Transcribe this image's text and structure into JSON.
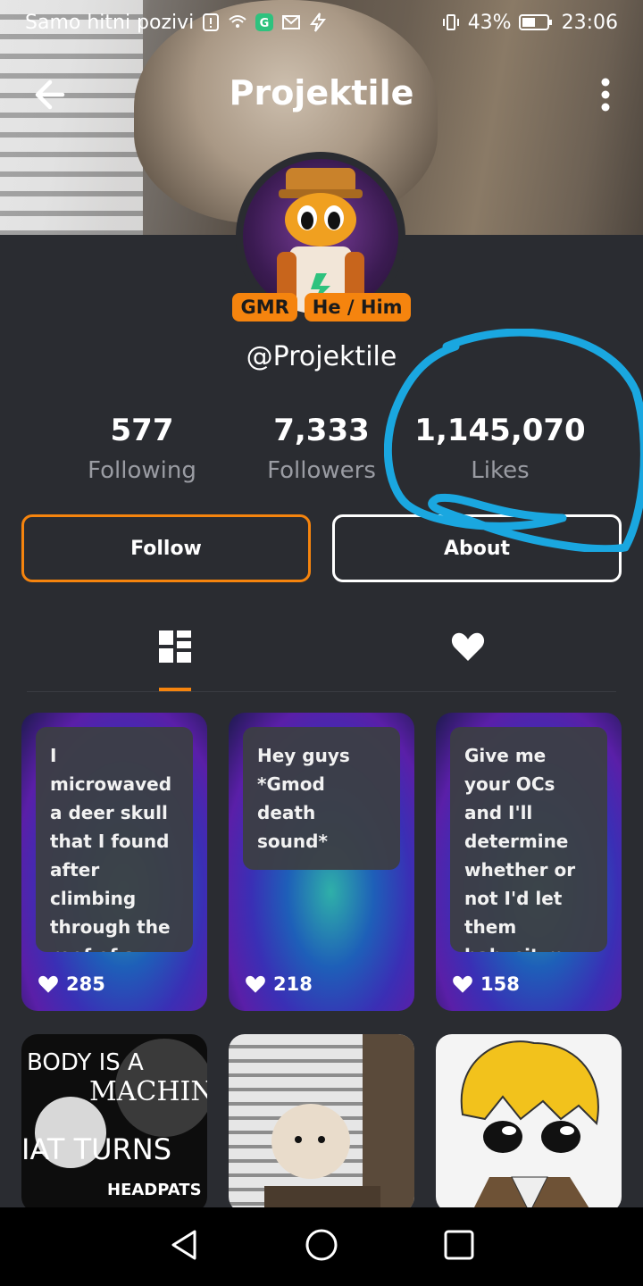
{
  "status_bar": {
    "carrier": "Samo hitni pozivi",
    "battery": "43%",
    "time": "23:06"
  },
  "header": {
    "title": "Projektile"
  },
  "profile": {
    "badges": [
      "GMR",
      "He / Him"
    ],
    "handle": "@Projektile",
    "stats": [
      {
        "value": "577",
        "label": "Following"
      },
      {
        "value": "7,333",
        "label": "Followers"
      },
      {
        "value": "1,145,070",
        "label": "Likes"
      }
    ]
  },
  "actions": {
    "follow": "Follow",
    "about": "About"
  },
  "tabs": [
    {
      "icon": "grid-icon",
      "active": true
    },
    {
      "icon": "heart-icon",
      "active": false
    }
  ],
  "posts": [
    {
      "text": "I microwaved a deer skull that I found after climbing through the roof of a",
      "likes": "285"
    },
    {
      "text": "Hey guys *Gmod death sound*",
      "likes": "218"
    },
    {
      "text": "Give me your OCs and I'll determine whether or not I'd let them babysit my children.",
      "likes": "158"
    }
  ],
  "thumbnails": [
    {
      "caption_top": "BODY IS A",
      "caption_mid": "MACHIN",
      "caption_low": "IAT TURNS",
      "caption_bottom": "HEADPATS"
    },
    {
      "caption": ""
    },
    {
      "caption": ""
    }
  ],
  "colors": {
    "accent": "#f5840e",
    "annotation": "#1aa7e0",
    "background": "#2a2c31"
  }
}
